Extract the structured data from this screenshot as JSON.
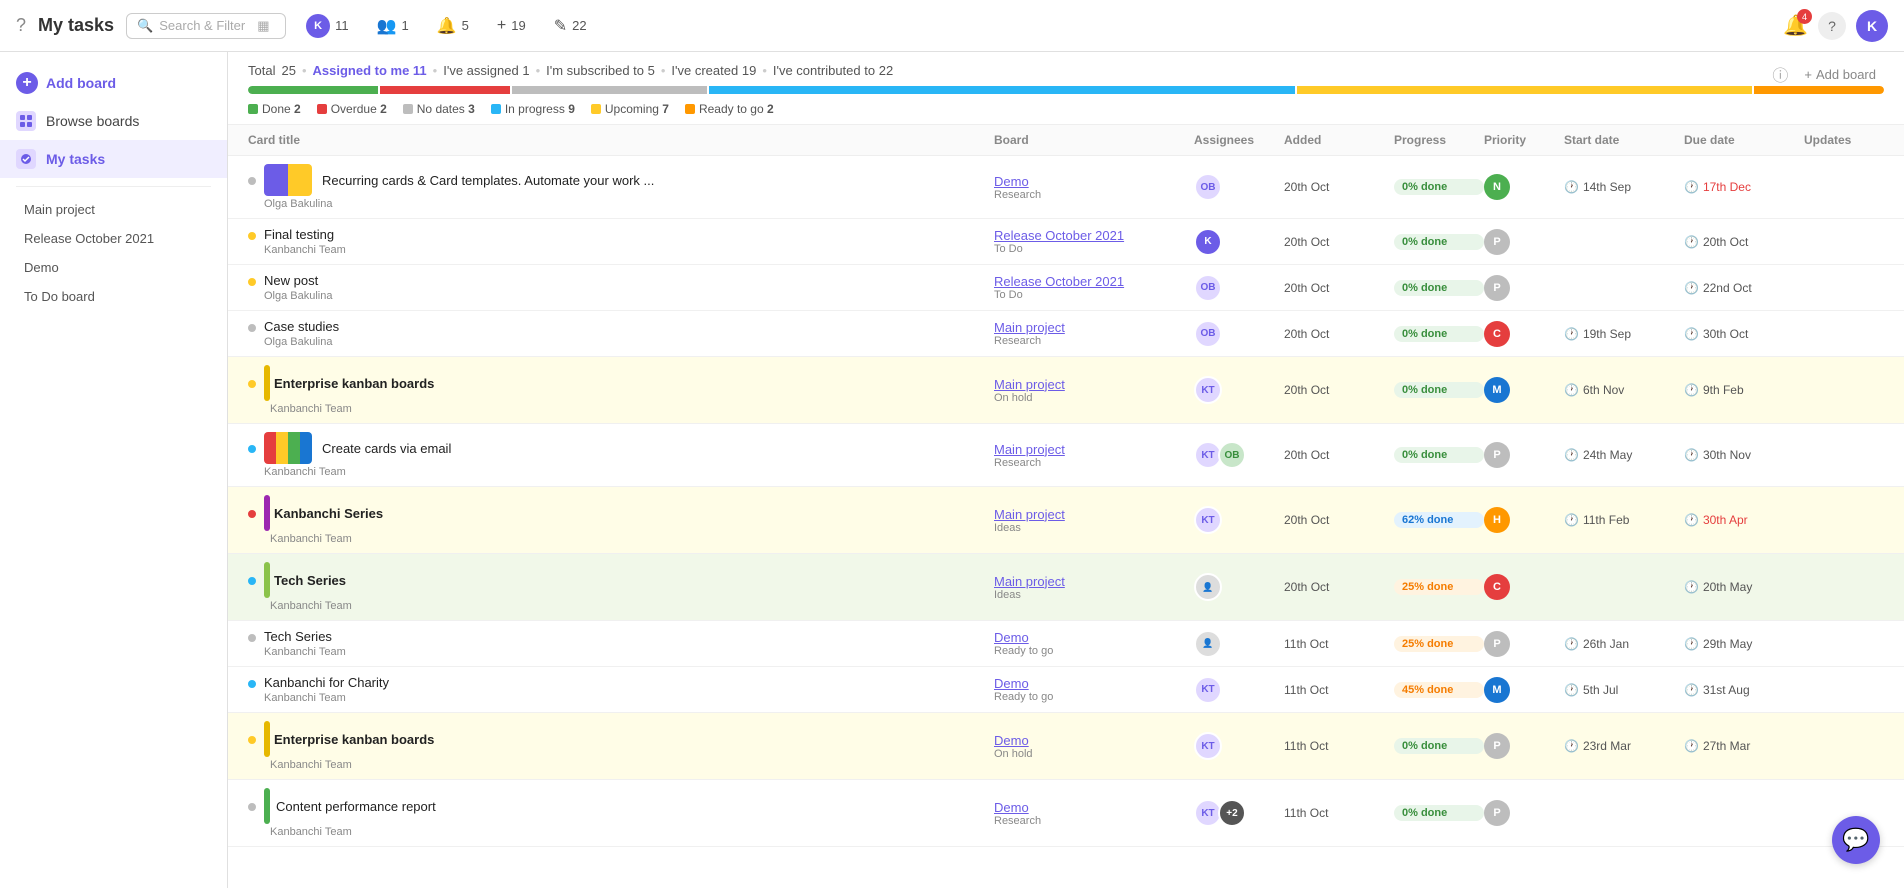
{
  "header": {
    "title": "My tasks",
    "search_placeholder": "Search & Filter",
    "help_icon": "?",
    "user_initials": "K",
    "badge_k": "K",
    "badge_k_count": "11",
    "badge_people": "1",
    "badge_bell": "5",
    "badge_plus": "19",
    "badge_pencil": "22",
    "notif_count": "4"
  },
  "sidebar": {
    "add_board_label": "Add board",
    "browse_boards_label": "Browse boards",
    "my_tasks_label": "My tasks",
    "projects": [
      "Main project",
      "Release October 2021",
      "Demo",
      "To Do board"
    ]
  },
  "stats": {
    "total_label": "Total",
    "total": "25",
    "assigned_to_me_label": "Assigned to me",
    "assigned_to_me": "11",
    "ive_assigned_label": "I've assigned",
    "ive_assigned": "1",
    "im_subscribed_label": "I'm subscribed to",
    "im_subscribed": "5",
    "ive_created_label": "I've created",
    "ive_created": "19",
    "ive_contributed_label": "I've contributed to",
    "ive_contributed": "22",
    "add_board_label": "Add board",
    "legend": [
      {
        "label": "Done",
        "count": "2",
        "color": "#4caf50"
      },
      {
        "label": "Overdue",
        "count": "2",
        "color": "#e53e3e"
      },
      {
        "label": "No dates",
        "count": "3",
        "color": "#bdbdbd"
      },
      {
        "label": "In progress",
        "count": "9",
        "color": "#29b6f6"
      },
      {
        "label": "Upcoming",
        "count": "7",
        "color": "#ffca28"
      },
      {
        "label": "Ready to go",
        "count": "2",
        "color": "#ff9800"
      }
    ],
    "progress_bars": [
      {
        "color": "#4caf50",
        "flex": 8
      },
      {
        "color": "#e53e3e",
        "flex": 8
      },
      {
        "color": "#bdbdbd",
        "flex": 12
      },
      {
        "color": "#29b6f6",
        "flex": 36
      },
      {
        "color": "#ffca28",
        "flex": 28
      },
      {
        "color": "#ff9800",
        "flex": 8
      }
    ]
  },
  "table": {
    "columns": [
      "Card title",
      "Board",
      "Assignees",
      "Progress",
      "Priority",
      "Start date",
      "Due date",
      "Updates"
    ],
    "rows": [
      {
        "dot_color": "#bdbdbd",
        "title": "Recurring cards & Card templates. Automate your work ...",
        "subtitle": "Olga Bakulina",
        "board_name": "Demo",
        "board_list": "Research",
        "added": "20th Oct",
        "progress": "0% done",
        "progress_class": "progress-0",
        "priority_letter": "N",
        "priority_color": "#4caf50",
        "start_date": "14th Sep",
        "due_date": "17th Dec",
        "due_overdue": true,
        "has_thumbnail": true,
        "thumb_colors": [
          "#6c5ce7",
          "#ffca28"
        ]
      },
      {
        "dot_color": "#ffca28",
        "title": "Final testing",
        "subtitle": "Kanbanchi Team",
        "board_name": "Release October 2021",
        "board_list": "To Do",
        "added": "20th Oct",
        "progress": "0% done",
        "progress_class": "progress-0",
        "priority_letter": "P",
        "priority_color": "#bdbdbd",
        "start_date": "",
        "due_date": "20th Oct",
        "due_overdue": false
      },
      {
        "dot_color": "#ffca28",
        "title": "New post",
        "subtitle": "Olga Bakulina",
        "board_name": "Release October 2021",
        "board_list": "To Do",
        "added": "20th Oct",
        "progress": "0% done",
        "progress_class": "progress-0",
        "priority_letter": "P",
        "priority_color": "#bdbdbd",
        "start_date": "",
        "due_date": "22nd Oct",
        "due_overdue": false
      },
      {
        "dot_color": "#bdbdbd",
        "title": "Case studies",
        "subtitle": "Olga Bakulina",
        "board_name": "Main project",
        "board_list": "Research",
        "added": "20th Oct",
        "progress": "0% done",
        "progress_class": "progress-0",
        "priority_letter": "C",
        "priority_color": "#e53e3e",
        "start_date": "19th Sep",
        "due_date": "30th Oct",
        "due_overdue": false
      },
      {
        "dot_color": "#ffca28",
        "title": "Enterprise kanban boards",
        "subtitle": "Kanbanchi Team",
        "board_name": "Main project",
        "board_list": "On hold",
        "added": "20th Oct",
        "progress": "0% done",
        "progress_class": "progress-0",
        "priority_letter": "M",
        "priority_color": "#1976d2",
        "start_date": "6th Nov",
        "due_date": "9th Feb",
        "due_overdue": false,
        "row_class": "row-yellow",
        "bold": true
      },
      {
        "dot_color": "#29b6f6",
        "title": "Create cards via email",
        "subtitle": "Kanbanchi Team",
        "board_name": "Main project",
        "board_list": "Research",
        "added": "20th Oct",
        "progress": "0% done",
        "progress_class": "progress-0",
        "priority_letter": "P",
        "priority_color": "#bdbdbd",
        "start_date": "24th May",
        "due_date": "30th Nov",
        "due_overdue": false,
        "has_thumbnail": true,
        "thumb_colors": [
          "#e53e3e",
          "#ffca28",
          "#4caf50",
          "#1976d2"
        ]
      },
      {
        "dot_color": "#e53e3e",
        "title": "Kanbanchi Series",
        "subtitle": "Kanbanchi Team",
        "board_name": "Main project",
        "board_list": "Ideas",
        "added": "20th Oct",
        "progress": "62% done",
        "progress_class": "progress-62",
        "priority_letter": "H",
        "priority_color": "#ff9800",
        "start_date": "11th Feb",
        "due_date": "30th Apr",
        "due_overdue": true,
        "row_class": "row-yellow",
        "bold": true
      },
      {
        "dot_color": "#29b6f6",
        "title": "Tech Series",
        "subtitle": "Kanbanchi Team",
        "board_name": "Main project",
        "board_list": "Ideas",
        "added": "20th Oct",
        "progress": "25% done",
        "progress_class": "progress-25",
        "priority_letter": "C",
        "priority_color": "#e53e3e",
        "start_date": "",
        "due_date": "20th May",
        "due_overdue": false,
        "row_class": "row-green",
        "bold": true
      },
      {
        "dot_color": "#bdbdbd",
        "title": "Tech Series",
        "subtitle": "Kanbanchi Team",
        "board_name": "Demo",
        "board_list": "Ready to go",
        "added": "11th Oct",
        "progress": "25% done",
        "progress_class": "progress-25",
        "priority_letter": "P",
        "priority_color": "#bdbdbd",
        "start_date": "26th Jan",
        "due_date": "29th May",
        "due_overdue": false
      },
      {
        "dot_color": "#29b6f6",
        "title": "Kanbanchi for Charity",
        "subtitle": "Kanbanchi Team",
        "board_name": "Demo",
        "board_list": "Ready to go",
        "added": "11th Oct",
        "progress": "45% done",
        "progress_class": "progress-45",
        "priority_letter": "M",
        "priority_color": "#1976d2",
        "start_date": "5th Jul",
        "due_date": "31st Aug",
        "due_overdue": false
      },
      {
        "dot_color": "#ffca28",
        "title": "Enterprise kanban boards",
        "subtitle": "Kanbanchi Team",
        "board_name": "Demo",
        "board_list": "On hold",
        "added": "11th Oct",
        "progress": "0% done",
        "progress_class": "progress-0",
        "priority_letter": "P",
        "priority_color": "#bdbdbd",
        "start_date": "23rd Mar",
        "due_date": "27th Mar",
        "due_overdue": false,
        "row_class": "row-yellow",
        "bold": true
      },
      {
        "dot_color": "#bdbdbd",
        "title": "Content performance report",
        "subtitle": "Kanbanchi Team",
        "board_name": "Demo",
        "board_list": "Research",
        "added": "11th Oct",
        "progress": "0% done",
        "progress_class": "progress-0",
        "priority_letter": "P",
        "priority_color": "#bdbdbd",
        "start_date": "",
        "due_date": "",
        "due_overdue": false,
        "extra_assignees": "+2"
      }
    ]
  }
}
